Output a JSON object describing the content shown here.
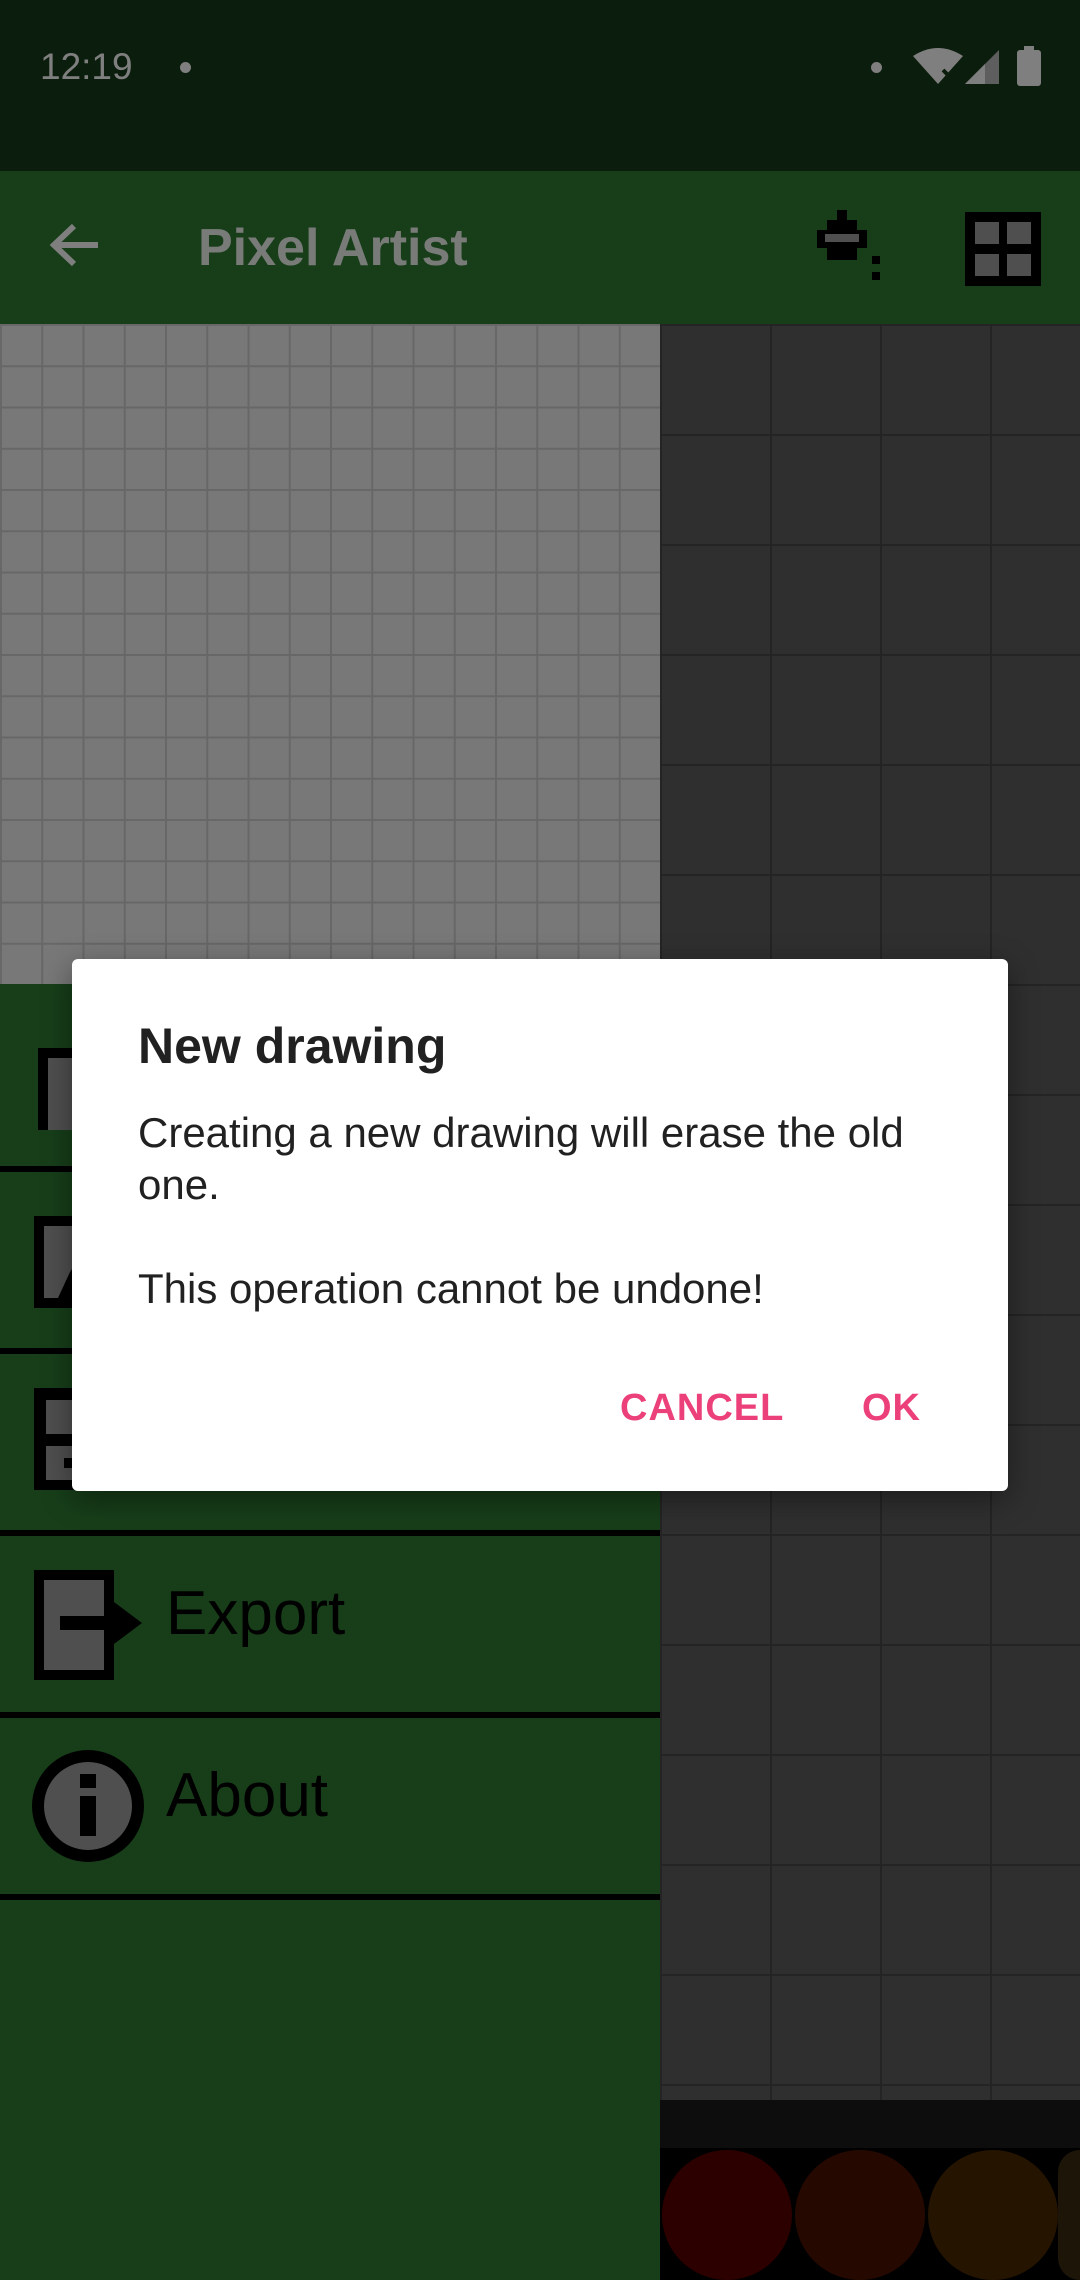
{
  "status_bar": {
    "time": "12:19",
    "icons": [
      "notification-dot-icon",
      "wifi-icon",
      "signal-icon",
      "battery-icon"
    ]
  },
  "app_bar": {
    "title": "Pixel Artist",
    "icons": [
      "back-arrow-icon",
      "paint-bucket-icon",
      "grid-icon"
    ]
  },
  "drawer": {
    "items": [
      {
        "label": "",
        "icon": "new-file-icon"
      },
      {
        "label": "",
        "icon": "open-image-icon"
      },
      {
        "label": "",
        "icon": "save-disk-icon"
      },
      {
        "label": "Export",
        "icon": "export-icon"
      },
      {
        "label": "About",
        "icon": "info-icon"
      }
    ]
  },
  "palette": {
    "colors": [
      "#5a0000",
      "#4a1300",
      "#4a2800",
      "#3a2a10"
    ]
  },
  "dialog": {
    "title": "New drawing",
    "message": "Creating a new drawing will erase the old one.\n\nThis operation cannot be undone!",
    "cancel_label": "CANCEL",
    "ok_label": "OK"
  },
  "colors": {
    "status_bar": "#173b18",
    "app_bar": "#2e7d32",
    "accent": "#ec407a"
  }
}
